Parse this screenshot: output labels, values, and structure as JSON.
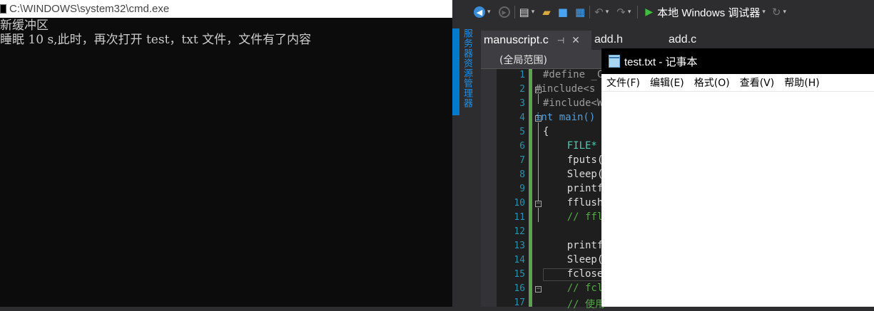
{
  "cmd": {
    "title": "C:\\WINDOWS\\system32\\cmd.exe",
    "lines": [
      "新缓冲区",
      "睡眠 10 s,此时，再次打开 test，txt 文件，文件有了内容"
    ]
  },
  "vs": {
    "toolbar": {
      "debugger_label": "本地 Windows 调试器"
    },
    "side_panel_label": "服务器资源管理器",
    "tabs": [
      {
        "label": "manuscript.c",
        "active": true
      },
      {
        "label": "add.h",
        "active": false
      },
      {
        "label": "add.c",
        "active": false
      }
    ],
    "scope": "(全局范围)",
    "line_numbers": [
      "1",
      "2",
      "3",
      "4",
      "5",
      "6",
      "7",
      "8",
      "9",
      "10",
      "11",
      "12",
      "13",
      "14",
      "15",
      "16",
      "17"
    ],
    "code_lines": [
      "#define _C",
      "#include<s",
      "#include<W",
      "int main()",
      "{",
      "    FILE*",
      "    fputs(",
      "    Sleep(",
      "    printf",
      "    fflush",
      "    // ffl",
      "",
      "    printf",
      "    Sleep(",
      "    fclose",
      "    // fcl",
      "    // 使用"
    ]
  },
  "notepad": {
    "title": "test.txt - 记事本",
    "menu": [
      "文件(F)",
      "编辑(E)",
      "格式(O)",
      "查看(V)",
      "帮助(H)"
    ],
    "content": ""
  },
  "colors": {
    "cmd_bg": "#0c0c0c",
    "vs_bg": "#2d2d30",
    "editor_bg": "#1e1e1e",
    "vs_accent": "#007acc",
    "change_bar": "#57a64a",
    "line_number": "#2b91af"
  }
}
